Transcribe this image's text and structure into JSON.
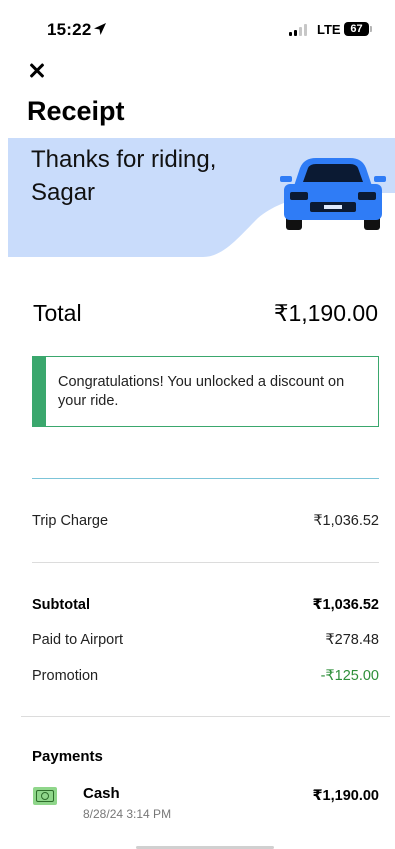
{
  "status_bar": {
    "time": "15:22",
    "network": "LTE",
    "battery": "67"
  },
  "header": {
    "title": "Receipt"
  },
  "banner": {
    "message": "Thanks for riding, Sagar",
    "bg_color": "#c9dcfb",
    "car_color": "#2f7cf6"
  },
  "total": {
    "label": "Total",
    "amount": "₹1,190.00"
  },
  "notice": {
    "text": "Congratulations! You unlocked a discount on your ride.",
    "accent_color": "#3aa76d"
  },
  "breakdown": {
    "trip_charge": {
      "label": "Trip Charge",
      "value": "₹1,036.52"
    },
    "subtotal": {
      "label": "Subtotal",
      "value": "₹1,036.52"
    },
    "paid_to_airport": {
      "label": "Paid to Airport",
      "value": "₹278.48"
    },
    "promotion": {
      "label": "Promotion",
      "value": "-₹125.00"
    }
  },
  "payments": {
    "title": "Payments",
    "method": {
      "icon": "cash-icon",
      "label": "Cash",
      "date": "8/28/24 3:14 PM",
      "amount": "₹1,190.00"
    }
  }
}
